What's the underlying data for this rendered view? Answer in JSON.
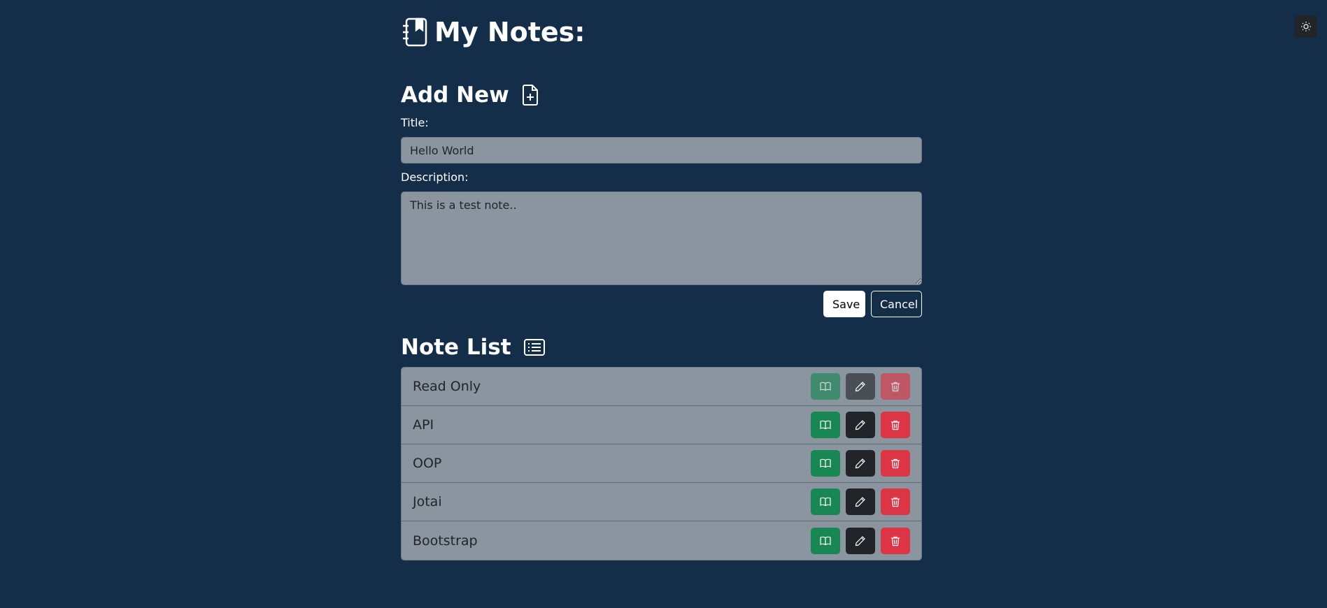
{
  "app": {
    "title": "My Notes:",
    "theme_toggle_icon": "sun-icon"
  },
  "add_new": {
    "heading": "Add New",
    "heading_icon": "file-plus-icon",
    "title_label": "Title:",
    "title_value": "Hello World",
    "description_label": "Description:",
    "description_value": "This is a test note..",
    "save_label": "Save",
    "cancel_label": "Cancel"
  },
  "note_list": {
    "heading": "Note List",
    "heading_icon": "list-icon",
    "notes": [
      {
        "title": "Read Only",
        "actions_disabled": true
      },
      {
        "title": "API",
        "actions_disabled": false
      },
      {
        "title": "OOP",
        "actions_disabled": false
      },
      {
        "title": "Jotai",
        "actions_disabled": false
      },
      {
        "title": "Bootstrap",
        "actions_disabled": false
      }
    ],
    "action_icons": [
      "book-icon",
      "pencil-icon",
      "trash-icon"
    ]
  },
  "colors": {
    "background": "#142d49",
    "panel": "#8a959f",
    "read_button": "#198754",
    "edit_button": "#212529",
    "delete_button": "#dc3545"
  }
}
